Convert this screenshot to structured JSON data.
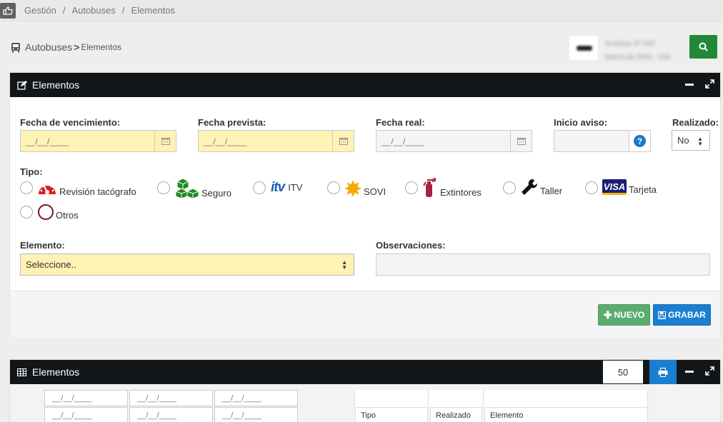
{
  "breadcrumb": {
    "items": [
      "Gestión",
      "Autobuses",
      "Elementos"
    ]
  },
  "page_header": {
    "section": "Autobuses",
    "subsection": "Elementos"
  },
  "user_box": {
    "line1": "Autobus Nº 000",
    "line2": "Matrícula 0000 - 000"
  },
  "form_panel": {
    "title": "Elementos",
    "fields": {
      "fecha_vencimiento": {
        "label": "Fecha de vencimiento:",
        "value": "__/__/____"
      },
      "fecha_prevista": {
        "label": "Fecha prevista:",
        "value": "__/__/____"
      },
      "fecha_real": {
        "label": "Fecha real:",
        "value": "__/__/____"
      },
      "inicio_aviso": {
        "label": "Inicio aviso:",
        "value": ""
      },
      "realizado": {
        "label": "Realizado:",
        "value": "No"
      },
      "tipo_label": "Tipo:",
      "elemento": {
        "label": "Elemento:",
        "value": "Seleccione.."
      },
      "observaciones": {
        "label": "Observaciones:",
        "value": ""
      }
    },
    "tipo_options": [
      {
        "label": "Revisión tacógrafo",
        "icon": "tachograph-icon"
      },
      {
        "label": "Seguro",
        "icon": "boxes-icon"
      },
      {
        "label": "ITV",
        "icon": "itv-logo",
        "logo_text": "itv"
      },
      {
        "label": "SOVI",
        "icon": "sun-icon"
      },
      {
        "label": "Extintores",
        "icon": "fire-extinguisher-icon"
      },
      {
        "label": "Taller",
        "icon": "wrench-icon"
      },
      {
        "label": "Tarjeta",
        "icon": "visa-card-icon",
        "logo_text": "VISA"
      },
      {
        "label": "Otros",
        "icon": "circle-icon"
      }
    ],
    "buttons": {
      "nuevo": "NUEVO",
      "grabar": "GRABAR"
    }
  },
  "list_panel": {
    "title": "Elementos",
    "rows_per_page": "50",
    "filter_value": "__/__/____",
    "columns": [
      "Tipo",
      "Realizado",
      "Elemento"
    ]
  },
  "colors": {
    "header_dark": "#121619",
    "required_field": "#fff2b5",
    "success": "#218838",
    "primary": "#1a7fd0"
  }
}
